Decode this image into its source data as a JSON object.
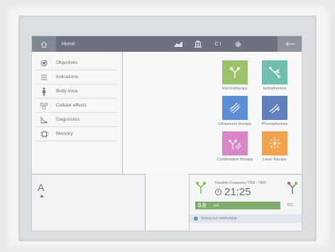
{
  "header": {
    "title": "Home",
    "home_icon": "home-icon",
    "icons": [
      "graph-icon",
      "library-icon",
      "gear-icon",
      "back-arrow-icon"
    ],
    "center_text": "C I"
  },
  "menu": {
    "items": [
      {
        "label": "Objectives",
        "icon": "target-icon"
      },
      {
        "label": "Indications",
        "icon": "list-icon"
      },
      {
        "label": "Body Area",
        "icon": "body-icon"
      },
      {
        "label": "Cellular effects",
        "icon": "cells-icon"
      },
      {
        "label": "Diagnostics",
        "icon": "curve-icon"
      },
      {
        "label": "Memory",
        "icon": "memory-icon"
      }
    ]
  },
  "therapies": [
    {
      "label": "Electrotherapy",
      "color": "#9cc36c",
      "icon": "electrode-icon"
    },
    {
      "label": "Iontophoresis",
      "color": "#6fc0b0",
      "icon": "ionto-icon"
    },
    {
      "label": "Ultrasound therapy",
      "color": "#5c8ed6",
      "icon": "ultrasound-icon"
    },
    {
      "label": "Phonophoresis",
      "color": "#5f7fbf",
      "icon": "phono-icon"
    },
    {
      "label": "Combination therapy",
      "color": "#d886c6",
      "icon": "combination-icon"
    },
    {
      "label": "Laser therapy",
      "color": "#f0a24c",
      "icon": "laser-icon"
    }
  ],
  "panel_a": {
    "letter": "A"
  },
  "panel_b": {
    "program_label": "Random Frequency 7096 - 7400",
    "time": "21:25",
    "intensity_value": "0.0",
    "intensity_unit": "mA",
    "intensity_fraction": 0,
    "mode": "CC",
    "status": "Strong but comfortable"
  }
}
